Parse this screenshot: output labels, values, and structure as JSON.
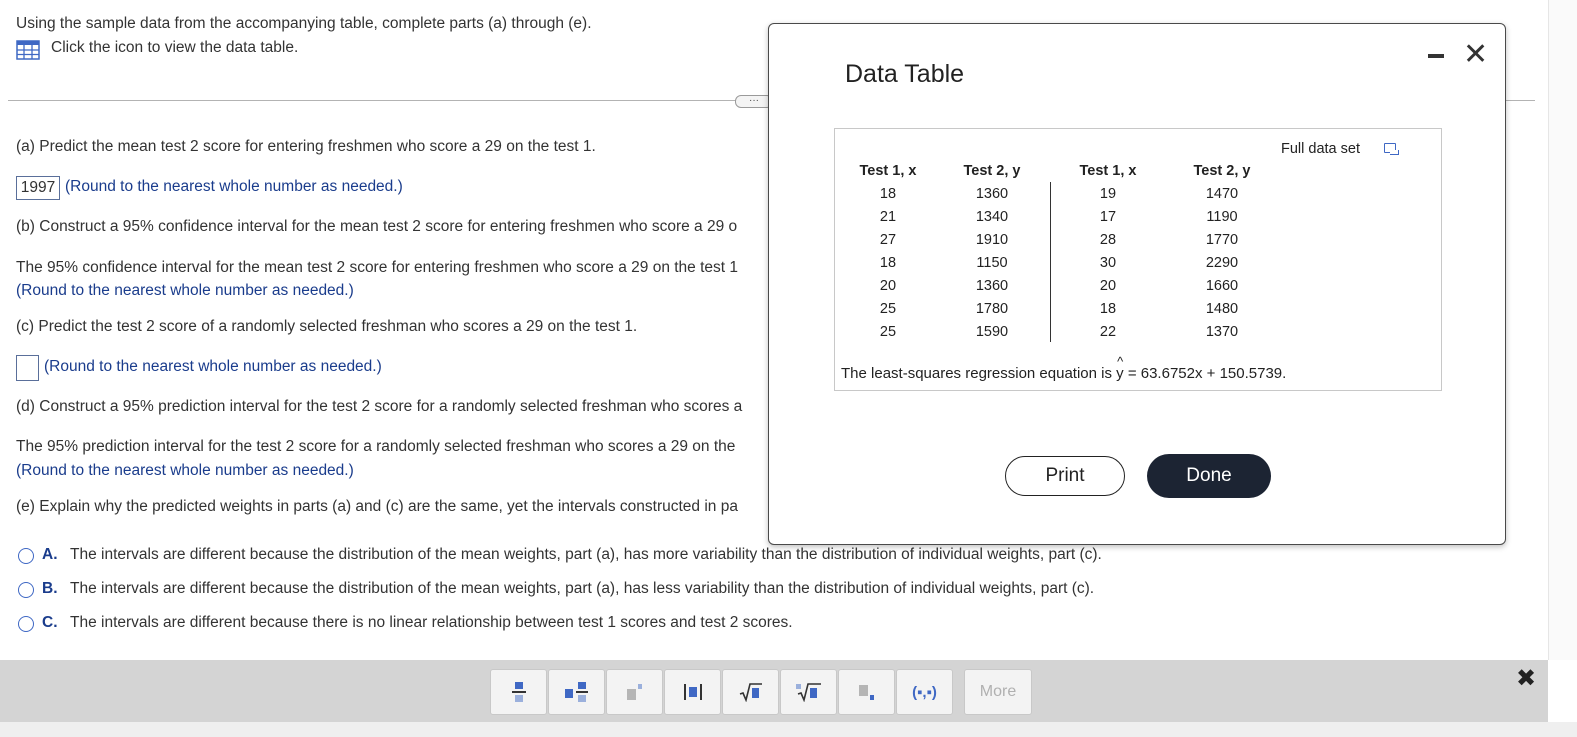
{
  "instructions": {
    "intro": "Using the sample data from the accompanying table, complete parts (a) through (e).",
    "view_table_link": "Click the icon to view the data table."
  },
  "part_a": {
    "question": "(a) Predict the mean test 2 score for entering freshmen who score a 29 on the test 1.",
    "answer": "1997",
    "hint": "(Round to the nearest whole number as needed.)"
  },
  "part_b": {
    "question": "(b) Construct a 95% confidence interval for the mean test 2 score for entering freshmen who score a 29 o",
    "statement": "The 95% confidence interval for the mean test 2 score for entering freshmen who score a 29 on the test 1",
    "hint": "(Round to the nearest whole number as needed.)"
  },
  "part_c": {
    "question": "(c) Predict the test 2 score of a randomly selected freshman who scores a 29 on the test 1.",
    "answer": "",
    "hint": "(Round to the nearest whole number as needed.)"
  },
  "part_d": {
    "question": "(d) Construct a 95% prediction interval for the test 2 score for a randomly selected freshman who scores a",
    "statement": "The 95% prediction interval for the test 2 score for a randomly selected freshman who scores a 29 on the",
    "hint": "(Round to the nearest whole number as needed.)"
  },
  "part_e": {
    "question": "(e) Explain why the predicted weights in parts (a) and (c) are the same, yet the intervals constructed in pa",
    "options": [
      {
        "letter": "A.",
        "text": "The intervals are different because the distribution of the mean weights, part (a), has more variability than the distribution of individual weights, part (c)."
      },
      {
        "letter": "B.",
        "text": "The intervals are different because the distribution of the mean weights, part (a), has less variability than the distribution of individual weights, part (c)."
      },
      {
        "letter": "C.",
        "text": "The intervals are different because there is no linear relationship between test 1 scores and test 2 scores."
      }
    ]
  },
  "expander_label": "···",
  "modal": {
    "title": "Data Table",
    "minimize_icon": "minimize-icon",
    "close_glyph": "✕",
    "full_data_set": "Full data set",
    "headers": [
      "Test 1, x",
      "Test 2, y",
      "Test 1, x",
      "Test 2, y"
    ],
    "left_rows": [
      [
        "18",
        "1360"
      ],
      [
        "21",
        "1340"
      ],
      [
        "27",
        "1910"
      ],
      [
        "18",
        "1150"
      ],
      [
        "20",
        "1360"
      ],
      [
        "25",
        "1780"
      ],
      [
        "25",
        "1590"
      ]
    ],
    "right_rows": [
      [
        "19",
        "1470"
      ],
      [
        "17",
        "1190"
      ],
      [
        "28",
        "1770"
      ],
      [
        "30",
        "2290"
      ],
      [
        "20",
        "1660"
      ],
      [
        "18",
        "1480"
      ],
      [
        "22",
        "1370"
      ]
    ],
    "regression_prefix": "The least-squares regression equation is ",
    "regression_var": "y",
    "regression_rhs": " = 63.6752x + 150.5739.",
    "print_label": "Print",
    "done_label": "Done"
  },
  "toolbar": {
    "tools": [
      "fraction-icon",
      "mixed-number-icon",
      "exponent-icon",
      "absolute-value-icon",
      "square-root-icon",
      "nth-root-icon",
      "subscript-icon",
      "ordered-pair-icon"
    ],
    "ordered_pair_label": "(▪,▪)",
    "more_label": "More",
    "close_glyph": "✖"
  },
  "colors": {
    "link_blue": "#1a3c8c",
    "radio_blue": "#3f68c4",
    "done_button": "#1c2433",
    "toolbar_bg": "#d4d4d4"
  }
}
